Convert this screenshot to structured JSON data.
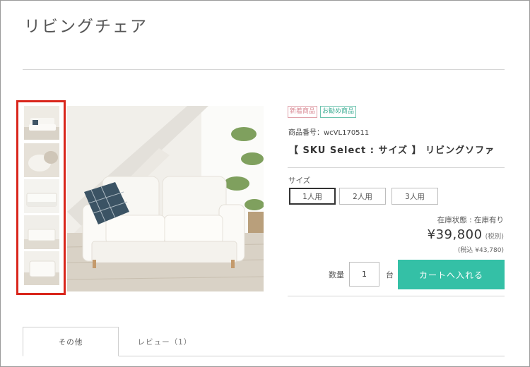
{
  "page": {
    "title": "リビングチェア"
  },
  "gallery": {
    "thumbnails": [
      "sofa-front",
      "cushion-closeup",
      "sofa-side",
      "sofa-room",
      "sofa-detail"
    ]
  },
  "product": {
    "badges": {
      "new": "新着商品",
      "recommended": "お勧め商品"
    },
    "sku": "商品番号：wcVL170511",
    "name": "【 SKU Select : サイズ 】 リビングソファ",
    "size_label": "サイズ",
    "size_options": [
      "1人用",
      "2人用",
      "3人用"
    ],
    "selected_size": "1人用",
    "stock": "在庫状態 : 在庫有り",
    "price": "¥39,800",
    "tax_note": "(税別)",
    "price_incl": "(税込 ¥43,780)",
    "qty_label": "数量",
    "qty_value": "1",
    "qty_unit": "台",
    "cart_button": "カートへ入れる"
  },
  "tabs": [
    "その他",
    "レビュー（1）"
  ],
  "colors": {
    "accent": "#34c0a6",
    "highlight": "#d9261c"
  }
}
